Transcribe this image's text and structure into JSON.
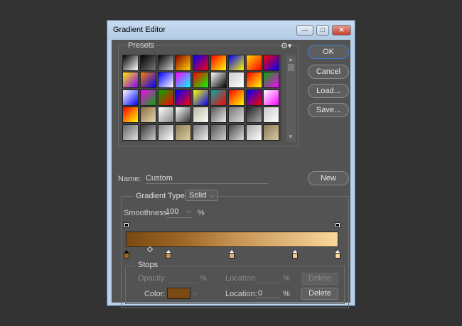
{
  "window": {
    "title": "Gradient Editor",
    "controls": [
      "—",
      "□",
      "✕"
    ]
  },
  "presets": {
    "label": "Presets",
    "gear_icon": "gear-icon",
    "rows": [
      [
        "#000000|#ffffff",
        "#000000|#777777",
        "#000000|#cccccc",
        "#8b0000|#ffd700",
        "#0000ff|#ff0000",
        "#ff0000|#ffff00",
        "#0000ff|#ffff00",
        "#ffd700|#ff0000",
        "#ff0000|#0000ff"
      ],
      [
        "#ffe600|#8800ff",
        "#ff7f00|#0000ff",
        "#0000ff|#ffffff",
        "#ff00ff|#00ffff",
        "#ff0000|#00ff00",
        "#ffffff|#000000",
        "#cccccc|#ffffff",
        "#ff0000|#ffff00",
        "#00aa00|#ff00ff"
      ],
      [
        "#ffffff|#0000ff",
        "#ff00ff|#00aa00",
        "#00aa00|#ff0000",
        "#0000ff|#ff0000",
        "#ffff00|#0000ff",
        "#00aaaa|#ff0000",
        "#ff0000|#ffff00",
        "#0000ff|#ff0000",
        "#ffffff|#ff00ff"
      ],
      [
        "#ff0000|#ffff00",
        "#8b6f3f|#e6d6b0",
        "#ffffff|#888888",
        "#ffffff|#333333",
        "#b8b8a0|#ffffff",
        "#555555|#eeeeee",
        "#777777|#dddddd",
        "#222222|#aaaaaa",
        "#c8c8c8|#ffffff"
      ],
      [
        "#666666|#dddddd",
        "#333333|#cccccc",
        "#888888|#ffffff",
        "#8a7a5a|#e0d0a0",
        "#777777|#eeeeee",
        "#555555|#cccccc",
        "#444444|#dddddd",
        "#aaaaaa|#ffffff",
        "#8a7a5a|#d8c8a0"
      ]
    ]
  },
  "buttons": {
    "ok": "OK",
    "cancel": "Cancel",
    "load": "Load...",
    "save": "Save...",
    "new": "New"
  },
  "name": {
    "label": "Name:",
    "value": "Custom"
  },
  "gradient": {
    "type_label": "Gradient Type:",
    "type_value": "Solid",
    "smoothness_label": "Smoothness:",
    "smoothness_value": "100",
    "smoothness_unit": "%",
    "colors": [
      "#7a4a12",
      "#9b6424",
      "#c49150",
      "#e0b477",
      "#f8d89a"
    ],
    "color_stop_fills": [
      "#9b6424",
      "#c49150",
      "#e0b477",
      "#f3cd8c",
      "#f8d89a"
    ]
  },
  "stops": {
    "label": "Stops",
    "opacity_label": "Opacity:",
    "opacity_value": "",
    "opacity_unit": "%",
    "opacity_location_label": "Location:",
    "opacity_location_value": "",
    "opacity_location_unit": "%",
    "delete_label": "Delete",
    "color_label": "Color:",
    "color_value": "#7a4a12",
    "color_location_label": "Location:",
    "color_location_value": "0",
    "color_location_unit": "%"
  }
}
